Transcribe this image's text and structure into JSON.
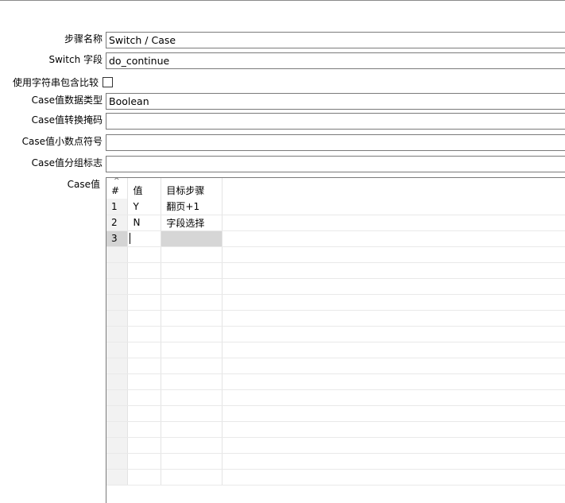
{
  "form": {
    "step_name_label": "步骤名称",
    "step_name_value": "Switch / Case",
    "switch_field_label": "Switch 字段",
    "switch_field_value": "do_continue",
    "string_compare_label": "使用字符串包含比较",
    "string_compare_checked": false,
    "case_type_label": "Case值数据类型",
    "case_type_value": "Boolean",
    "case_mask_label": "Case值转换掩码",
    "case_mask_value": "",
    "case_decimal_label": "Case值小数点符号",
    "case_decimal_value": "",
    "case_grouping_label": "Case值分组标志",
    "case_grouping_value": "",
    "case_values_label": "Case值"
  },
  "grid": {
    "columns": [
      "#",
      "值",
      "目标步骤"
    ],
    "rows": [
      {
        "num": "1",
        "value": "Y",
        "target": "翻页+1"
      },
      {
        "num": "2",
        "value": "N",
        "target": "字段选择"
      },
      {
        "num": "3",
        "value": "",
        "target": ""
      }
    ]
  }
}
